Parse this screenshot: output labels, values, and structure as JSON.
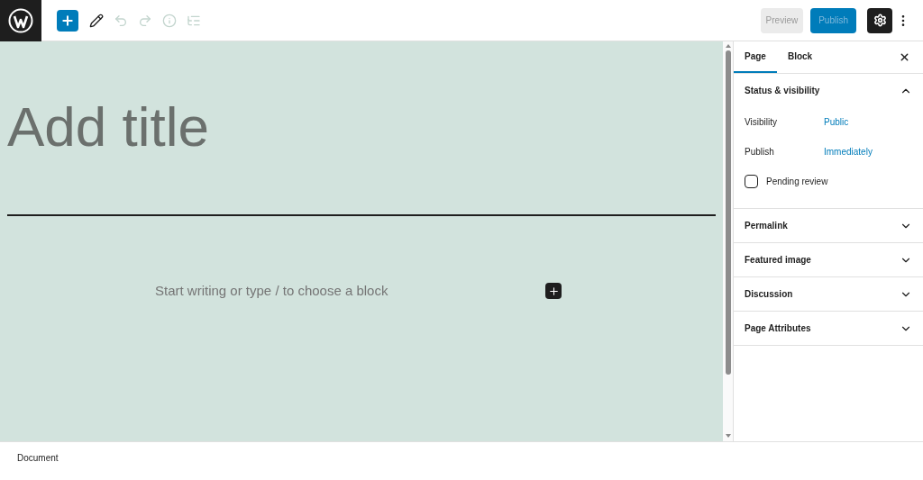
{
  "toolbar": {
    "tools": [
      {
        "kind": "edit",
        "disabled": false
      },
      {
        "kind": "undo",
        "disabled": true
      },
      {
        "kind": "redo",
        "disabled": true
      },
      {
        "kind": "info",
        "disabled": true
      },
      {
        "kind": "outline",
        "disabled": true
      }
    ],
    "preview": "Preview",
    "publish": "Publish",
    "settings_on": true
  },
  "editor": {
    "title_placeholder": "Add title",
    "body_placeholder": "Start writing or type / to choose a block"
  },
  "sidebar": {
    "tabs": [
      {
        "label": "Page",
        "selected": true
      },
      {
        "label": "Block",
        "selected": false
      }
    ],
    "panels": [
      {
        "title": "Status & visibility",
        "expanded": true,
        "rows": [
          {
            "label": "Visibility",
            "value": "Public"
          },
          {
            "label": "Publish",
            "value": "Immediately"
          }
        ],
        "checkbox": {
          "label": "Pending review",
          "checked": false
        }
      },
      {
        "title": "Permalink",
        "expanded": false
      },
      {
        "title": "Featured image",
        "expanded": false
      },
      {
        "title": "Discussion",
        "expanded": false
      },
      {
        "title": "Page Attributes",
        "expanded": false
      }
    ]
  },
  "footer": {
    "breadcrumb": "Document"
  }
}
